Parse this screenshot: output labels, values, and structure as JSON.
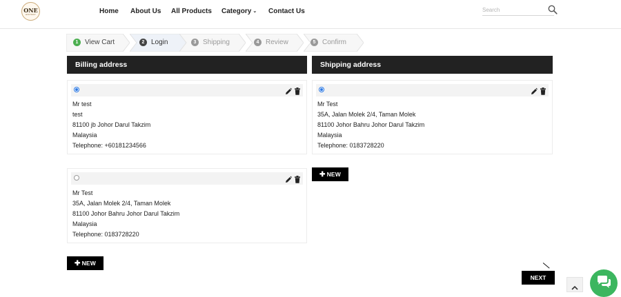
{
  "header": {
    "logo": {
      "big": "ONE",
      "small": "HISTORY"
    },
    "nav": [
      {
        "label": "Home"
      },
      {
        "label": "About Us"
      },
      {
        "label": "All Products"
      },
      {
        "label": "Category"
      },
      {
        "label": "Contact Us"
      }
    ],
    "search": {
      "placeholder": "Search",
      "value": ""
    }
  },
  "steps": [
    {
      "num": "1",
      "label": "View Cart",
      "state": "done"
    },
    {
      "num": "2",
      "label": "Login",
      "state": "current"
    },
    {
      "num": "3",
      "label": "Shipping",
      "state": "upcoming"
    },
    {
      "num": "4",
      "label": "Review",
      "state": "upcoming"
    },
    {
      "num": "5",
      "label": "Confirm",
      "state": "upcoming"
    }
  ],
  "billing": {
    "title": "Billing address",
    "addresses": [
      {
        "selected": true,
        "lines": [
          "Mr test",
          "test",
          "81100 jb Johor Darul Takzim",
          "Malaysia",
          "Telephone: +60181234566"
        ]
      },
      {
        "selected": false,
        "lines": [
          "Mr Test",
          "35A, Jalan Molek 2/4, Taman Molek",
          "81100 Johor Bahru Johor Darul Takzim",
          "Malaysia",
          "Telephone: 0183728220"
        ]
      }
    ],
    "new_label": "NEW"
  },
  "shipping": {
    "title": "Shipping address",
    "addresses": [
      {
        "selected": true,
        "lines": [
          "Mr Test",
          "35A, Jalan Molek 2/4, Taman Molek",
          "81100 Johor Bahru Johor Darul Takzim",
          "Malaysia",
          "Telephone: 0183728220"
        ]
      }
    ],
    "new_label": "NEW"
  },
  "actions": {
    "next_label": "NEXT"
  },
  "colors": {
    "header_bg": "#222222",
    "accent_radio": "#2b78e4",
    "step_done": "#4caf50",
    "step_current": "#444444",
    "step_upcoming": "#999999",
    "chat_green": "#3cb65f"
  },
  "icons": {
    "search": "search-icon",
    "edit": "pencil-icon",
    "delete": "trash-icon",
    "scroll_top": "chevron-up-icon",
    "chat": "chat-bubbles-icon"
  }
}
